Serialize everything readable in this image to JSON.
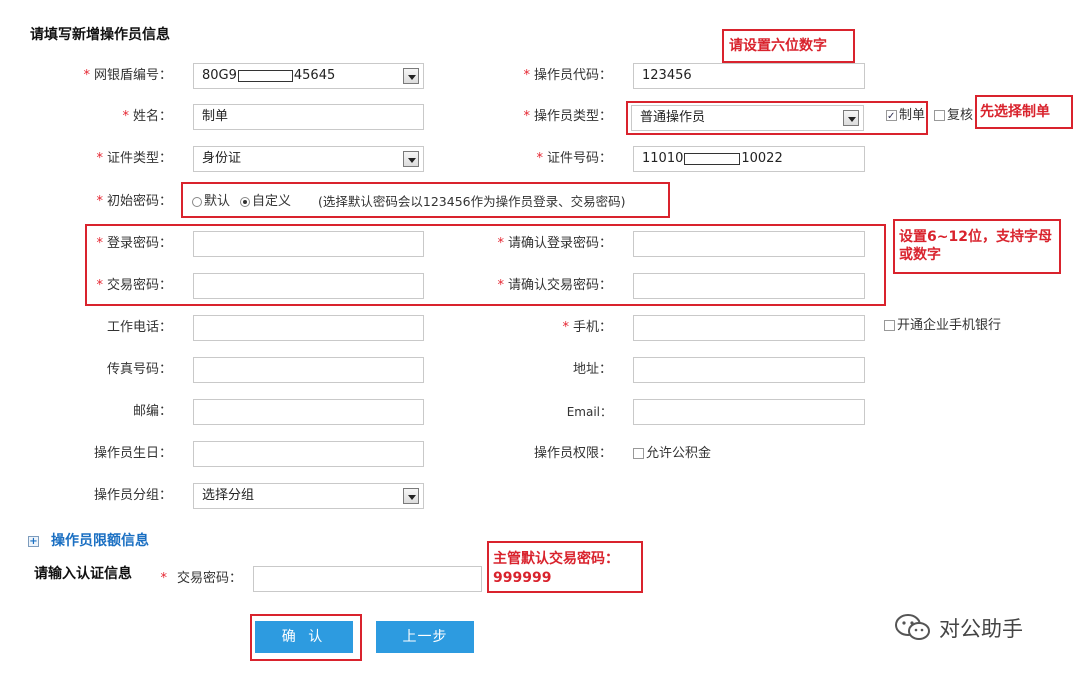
{
  "form": {
    "header": "请填写新增操作员信息",
    "shield_label": "网银盾编号：",
    "shield_value_prefix": "80G9",
    "shield_value_suffix": "45645",
    "op_code_label": "操作员代码：",
    "op_code_value": "123456",
    "name_label": "姓名：",
    "name_value": "制单",
    "op_type_label": "操作员类型：",
    "op_type_value": "普通操作员",
    "role_maker": "制单",
    "role_checker": "复核",
    "id_type_label": "证件类型：",
    "id_type_value": "身份证",
    "id_number_label": "证件号码：",
    "id_number_prefix": "11010",
    "id_number_suffix": "10022",
    "init_pwd_label": "初始密码：",
    "init_pwd_default": "默认",
    "init_pwd_custom": "自定义",
    "init_pwd_hint": "(选择默认密码会以123456作为操作员登录、交易密码)",
    "login_pwd_label": "登录密码：",
    "login_pwd_confirm_label": "请确认登录密码：",
    "trade_pwd_label": "交易密码：",
    "trade_pwd_confirm_label": "请确认交易密码：",
    "work_phone_label": "工作电话：",
    "mobile_label": "手机：",
    "mobile_bank_option": "开通企业手机银行",
    "fax_label": "传真号码：",
    "address_label": "地址：",
    "zip_label": "邮编：",
    "email_label": "Email：",
    "birthday_label": "操作员生日：",
    "permission_label": "操作员权限：",
    "permission_option": "允许公积金",
    "group_label": "操作员分组：",
    "group_value": "选择分组",
    "limit_section": "操作员限额信息",
    "auth_header": "请输入认证信息",
    "auth_trade_pwd_label": "交易密码：",
    "confirm_button": "确 认",
    "prev_button": "上一步"
  },
  "annotations": {
    "six_digits": "请设置六位数字",
    "choose_maker": "先选择制单",
    "pwd_rule": "设置6~12位，支持字母或数字",
    "supervisor_pwd_line1": "主管默认交易密码：",
    "supervisor_pwd_line2": "999999"
  },
  "watermark": "对公助手",
  "colors": {
    "required": "#e5232f",
    "annotation": "#d9232d",
    "button": "#2d9be0",
    "section_link": "#1a6fc2"
  }
}
